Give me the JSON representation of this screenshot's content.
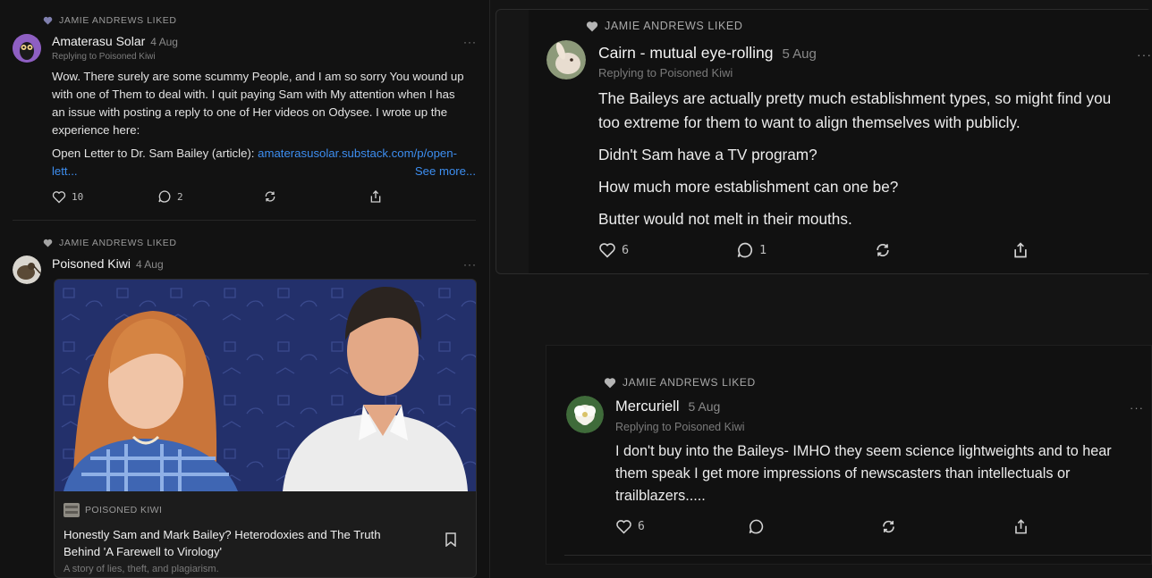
{
  "left": {
    "post1": {
      "liked_label": "JAMIE ANDREWS LIKED",
      "author": "Amaterasu Solar",
      "date": "4 Aug",
      "replying": "Replying to Poisoned Kiwi",
      "body_lines": [
        "Wow. There surely are some scummy People, and I am so sorry You wound up",
        "with one of Them to deal with. I quit paying Sam with My attention when I has",
        "an issue with posting a reply to one of Her videos on Odysee. I wrote up the",
        "experience here:"
      ],
      "link_prefix": "Open Letter to Dr. Sam Bailey (article): ",
      "link_text_1": "amaterasusolar.substack.com/p/open-",
      "link_text_2": "lett...",
      "see_more": "See more...",
      "likes": "10",
      "comments": "2",
      "more": "···"
    },
    "post2": {
      "liked_label": "JAMIE ANDREWS LIKED",
      "author": "Poisoned Kiwi",
      "date": "4 Aug",
      "more": "···",
      "card": {
        "publication": "POISONED KIWI",
        "title_line1": "Honestly Sam and Mark Bailey? Heterodoxies and The Truth",
        "title_line2": "Behind 'A Farewell to Virology'",
        "subtitle": "A story of lies, theft, and plagiarism."
      }
    }
  },
  "right_top": {
    "liked_label": "JAMIE ANDREWS LIKED",
    "author": "Cairn - mutual eye-rolling",
    "date": "5 Aug",
    "replying": "Replying to Poisoned Kiwi",
    "paragraphs": [
      "The Baileys are actually pretty much establishment types, so might find you",
      "too extreme for them to want to align themselves with publicly.",
      "Didn't Sam have a TV program?",
      "How much more establishment can one be?",
      "Butter would not melt in their mouths."
    ],
    "likes": "6",
    "comments": "1",
    "more": "···"
  },
  "right_bottom": {
    "liked_label": "JAMIE ANDREWS LIKED",
    "author": "Mercuriell",
    "date": "5 Aug",
    "replying": "Replying to Poisoned Kiwi",
    "body_lines": [
      "I don't buy into the Baileys- IMHO they seem science lightweights and to hear",
      "them speak I get more impressions of newscasters than intellectuals or",
      "trailblazers....."
    ],
    "likes": "6",
    "more": "···"
  },
  "colors": {
    "link": "#3d8ef0",
    "background": "#121212",
    "card_image_bg": "#23306b"
  },
  "icons": [
    "heart-icon",
    "comment-icon",
    "restack-icon",
    "share-icon",
    "bookmark-icon",
    "more-icon"
  ]
}
